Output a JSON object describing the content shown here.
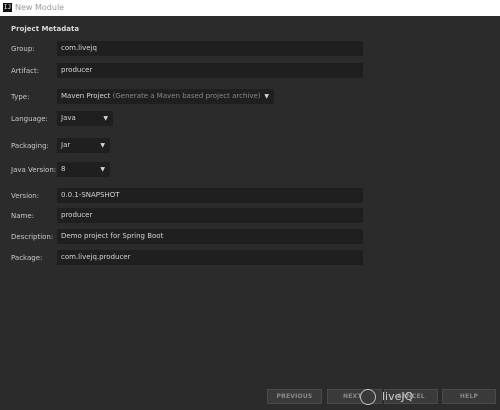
{
  "window": {
    "title": "New Module",
    "logo_glyph": "IJ"
  },
  "section": {
    "title": "Project Metadata"
  },
  "form": {
    "group": {
      "label": "Group:",
      "value": "com.livejq"
    },
    "artifact": {
      "label": "Artifact:",
      "value": "producer"
    },
    "type": {
      "label": "Type:",
      "value": "Maven Project",
      "hint": "(Generate a Maven based project archive)"
    },
    "language": {
      "label": "Language:",
      "value": "Java"
    },
    "packaging": {
      "label": "Packaging:",
      "value": "Jar"
    },
    "java_version": {
      "label": "Java Version:",
      "value": "8"
    },
    "version": {
      "label": "Version:",
      "value": "0.0.1-SNAPSHOT"
    },
    "name": {
      "label": "Name:",
      "value": "producer"
    },
    "description": {
      "label": "Description:",
      "value": "Demo project for Spring Boot"
    },
    "package": {
      "label": "Package:",
      "value": "com.livejq.producer"
    }
  },
  "buttons": {
    "previous": "PREVIOUS",
    "next": "NEXT",
    "cancel": "CANCEL",
    "help": "HELP"
  },
  "watermark": {
    "text": "liveJQ"
  },
  "icons": {
    "dropdown": "chevron-down-icon",
    "logo": "intellij-logo-icon"
  }
}
